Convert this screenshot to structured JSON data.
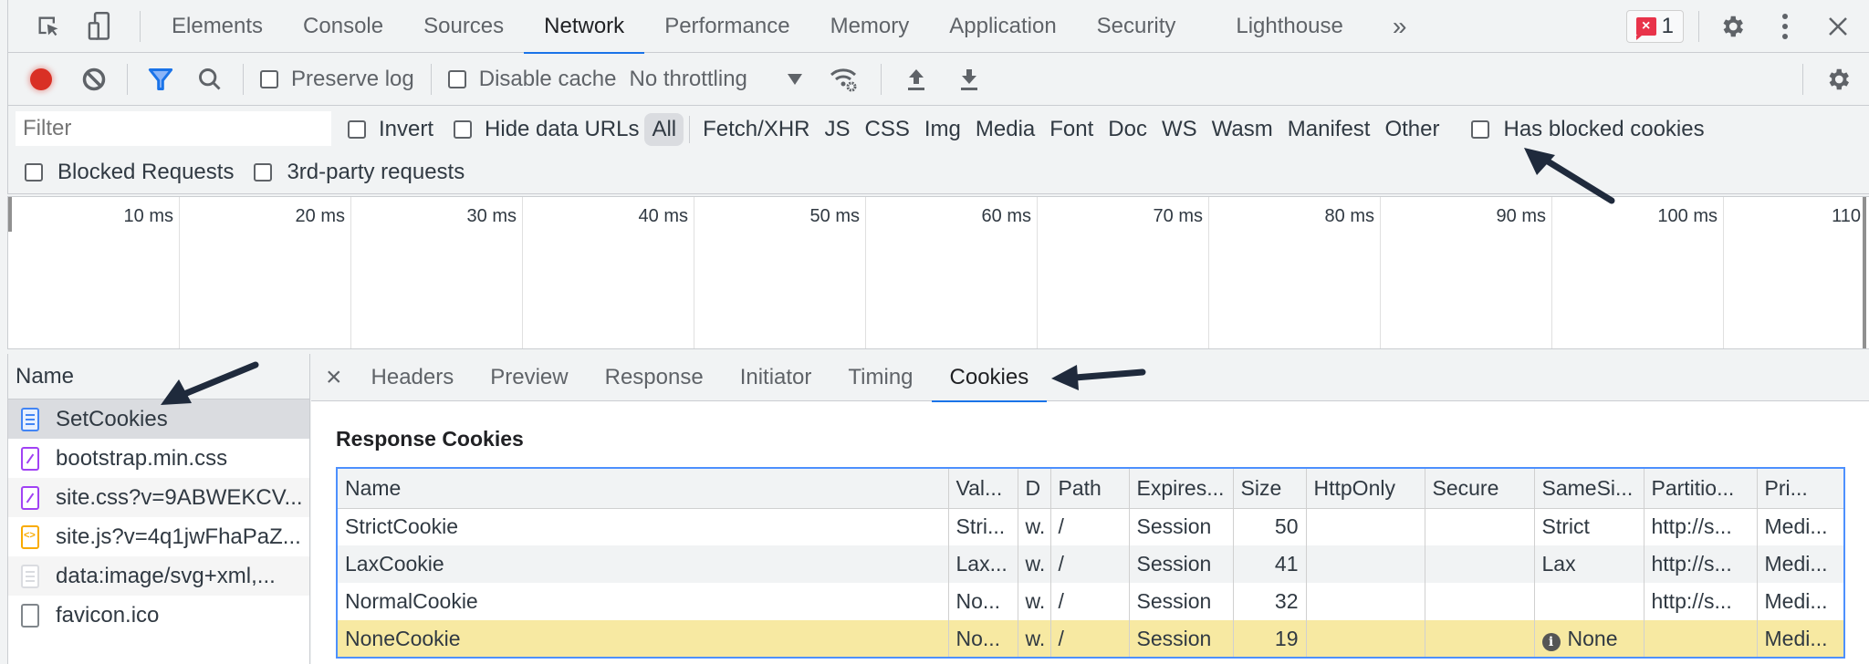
{
  "main_tabs": [
    "Elements",
    "Console",
    "Sources",
    "Network",
    "Performance",
    "Memory",
    "Application",
    "Security",
    "Lighthouse"
  ],
  "active_main_tab": "Network",
  "more_tabs_label": "»",
  "error_badge": {
    "count": "1",
    "icon": "error-message-icon",
    "color": "#e8334a"
  },
  "toolbar": {
    "preserve_log": "Preserve log",
    "disable_cache": "Disable cache",
    "throttling": "No throttling",
    "colors": {
      "record": "#d93025",
      "filter": "#1a73e8"
    }
  },
  "filter": {
    "placeholder": "Filter",
    "invert": "Invert",
    "hide_data_urls": "Hide data URLs",
    "types": [
      "All",
      "Fetch/XHR",
      "JS",
      "CSS",
      "Img",
      "Media",
      "Font",
      "Doc",
      "WS",
      "Wasm",
      "Manifest",
      "Other"
    ],
    "active_type": "All",
    "has_blocked_cookies": "Has blocked cookies",
    "blocked_requests": "Blocked Requests",
    "third_party": "3rd-party requests"
  },
  "timeline": {
    "ticks": [
      "10 ms",
      "20 ms",
      "30 ms",
      "40 ms",
      "50 ms",
      "60 ms",
      "70 ms",
      "80 ms",
      "90 ms",
      "100 ms",
      "110"
    ]
  },
  "requests": {
    "header": "Name",
    "items": [
      {
        "name": "SetCookies",
        "type": "document",
        "selected": true
      },
      {
        "name": "bootstrap.min.css",
        "type": "stylesheet"
      },
      {
        "name": "site.css?v=9ABWEKCV...",
        "type": "stylesheet"
      },
      {
        "name": "site.js?v=4q1jwFhaPaZ...",
        "type": "script"
      },
      {
        "name": "data:image/svg+xml,...",
        "type": "other"
      },
      {
        "name": "favicon.ico",
        "type": "blank"
      }
    ]
  },
  "details": {
    "close_label": "×",
    "tabs": [
      "Headers",
      "Preview",
      "Response",
      "Initiator",
      "Timing",
      "Cookies"
    ],
    "active_tab": "Cookies",
    "section_title": "Response Cookies",
    "columns": [
      "Name",
      "Val...",
      "D",
      "Path",
      "Expires...",
      "Size",
      "HttpOnly",
      "Secure",
      "SameSi...",
      "Partitio...",
      "Pri..."
    ],
    "rows": [
      {
        "name": "StrictCookie",
        "value": "Stri...",
        "domain": "w.",
        "path": "/",
        "expires": "Session",
        "size": "50",
        "httponly": "",
        "secure": "",
        "samesite": "Strict",
        "partition": "http://s...",
        "priority": "Medi..."
      },
      {
        "name": "LaxCookie",
        "value": "Lax...",
        "domain": "w.",
        "path": "/",
        "expires": "Session",
        "size": "41",
        "httponly": "",
        "secure": "",
        "samesite": "Lax",
        "partition": "http://s...",
        "priority": "Medi..."
      },
      {
        "name": "NormalCookie",
        "value": "No...",
        "domain": "w.",
        "path": "/",
        "expires": "Session",
        "size": "32",
        "httponly": "",
        "secure": "",
        "samesite": "",
        "partition": "http://s...",
        "priority": "Medi..."
      },
      {
        "name": "NoneCookie",
        "value": "No...",
        "domain": "w.",
        "path": "/",
        "expires": "Session",
        "size": "19",
        "httponly": "",
        "secure": "",
        "samesite": "None",
        "samesite_icon": "info-icon",
        "partition": "",
        "priority": "Medi...",
        "warning": true
      }
    ],
    "warning_row_color": "#f7e9a2"
  }
}
